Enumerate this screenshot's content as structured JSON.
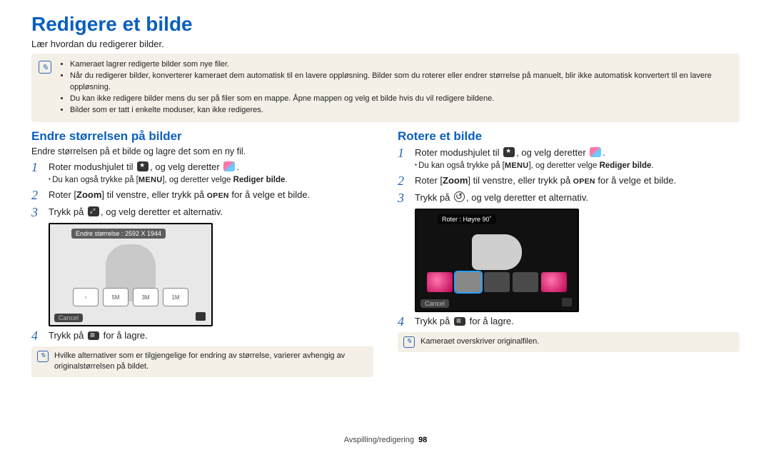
{
  "title": "Redigere et bilde",
  "lead": "Lær hvordan du redigerer bilder.",
  "notes": [
    "Kameraet lagrer redigerte bilder som nye filer.",
    "Når du redigerer bilder, konverterer kameraet dem automatisk til en lavere oppløsning. Bilder som du roterer eller endrer størrelse på manuelt, blir ikke automatisk konvertert til en lavere oppløsning.",
    "Du kan ikke redigere bilder mens du ser på filer som en mappe. Åpne mappen og velg et bilde hvis du vil redigere bildene.",
    "Bilder som er tatt i enkelte moduser, kan ikke redigeres."
  ],
  "left": {
    "heading": "Endre størrelsen på bilder",
    "desc": "Endre størrelsen på et bilde og lagre det som en ny fil.",
    "step1a": "Roter modushjulet til ",
    "step1b": ", og velg deretter ",
    "step1c": ".",
    "sub_a": "Du kan også trykke på [",
    "sub_b": "], og deretter velge ",
    "sub_bold": "Rediger bilde",
    "sub_c": ".",
    "step2a": "Roter [",
    "step2zoom": "Zoom",
    "step2b": "] til venstre, eller trykk på ",
    "step2open": "OPEN",
    "step2c": " for å velge et bilde.",
    "step3a": "Trykk på ",
    "step3b": ", og velg deretter et alternativ.",
    "screen_label": "Endre størrelse : 2592 X 1944",
    "cancel": "Cancel",
    "size_opts": [
      "▫",
      "5M",
      "3M",
      "1M"
    ],
    "step4a": "Trykk på ",
    "step4b": " for å lagre.",
    "note": "Hvilke alternativer som er tilgjengelige for endring av størrelse, varierer avhengig av originalstørrelsen på bildet."
  },
  "right": {
    "heading": "Rotere et bilde",
    "step1a": "Roter modushjulet til ",
    "step1b": ", og velg deretter ",
    "step1c": ".",
    "sub_a": "Du kan også trykke på [",
    "sub_b": "], og deretter velge ",
    "sub_bold": "Rediger bilde",
    "sub_c": ".",
    "step2a": "Roter [",
    "step2zoom": "Zoom",
    "step2b": "] til venstre, eller trykk på ",
    "step2open": "OPEN",
    "step2c": " for å velge et bilde.",
    "step3a": "Trykk på ",
    "step3b": ", og velg deretter et alternativ.",
    "screen_label": "Roter : Høyre 90˚",
    "cancel": "Cancel",
    "step4a": "Trykk på ",
    "step4b": " for å lagre.",
    "note": "Kameraet overskriver originalfilen."
  },
  "footer_section": "Avspilling/redigering",
  "footer_page": "98"
}
